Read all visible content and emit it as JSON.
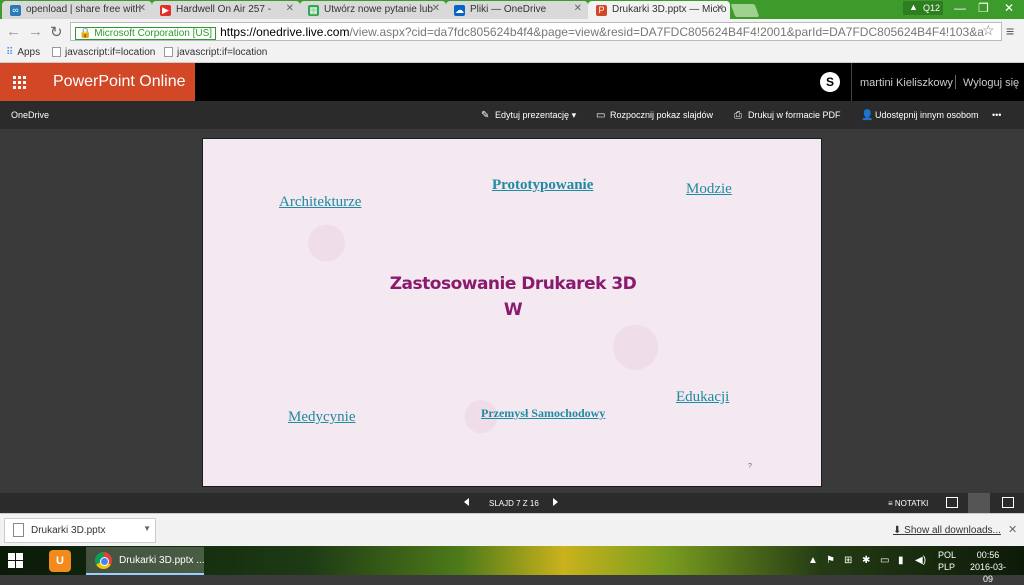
{
  "browser": {
    "tabs": [
      {
        "label": "openload | share free with",
        "icon": "openload-icon",
        "color": "#2a7ab8",
        "active": false
      },
      {
        "label": "Hardwell On Air 257 - ",
        "icon": "youtube-icon",
        "color": "#e52d27",
        "active": false
      },
      {
        "label": "Utwórz nowe pytanie lub",
        "icon": "windows-store-icon",
        "color": "#2fa84f",
        "active": false
      },
      {
        "label": "Pliki — OneDrive",
        "icon": "onedrive-icon",
        "color": "#0a64c8",
        "active": false
      },
      {
        "label": "Drukarki 3D.pptx — Micro",
        "icon": "powerpoint-icon",
        "color": "#d24726",
        "active": true
      }
    ],
    "user_badge": "Q12",
    "secure_label": "Microsoft Corporation [US]",
    "url_host": "https://onedrive.live.com",
    "url_path": "/view.aspx?cid=da7fdc805624b4f4&page=view&resid=DA7FDC805624B4F4!2001&parId=DA7FDC805624B4F4!103&a",
    "bookmarks": [
      "Apps",
      "javascript:if=location",
      "javascript:if=location"
    ]
  },
  "office": {
    "app_title": "PowerPoint Online",
    "user_name": "martini Kieliszkowy",
    "logout": "Wyloguj się",
    "breadcrumb": "OneDrive",
    "commands": {
      "edit": "Edytuj prezentację",
      "slideshow": "Rozpocznij pokaz slajdów",
      "print": "Drukuj w formacie PDF",
      "share": "Udostępnij innym osobom",
      "more": "•••"
    }
  },
  "slide": {
    "title_line1": "Zastosowanie Drukarek 3D",
    "title_line2": "W",
    "links": {
      "architecture": "Architekturze",
      "prototyping": "Prototypowanie",
      "fashion": "Modzie",
      "medicine": "Medycynie",
      "automotive": "Przemysł Samochodowy",
      "education": "Edukacji"
    },
    "small_mark": "?"
  },
  "status": {
    "slide_counter": "SLAJD 7 Z 16",
    "notes": "NOTATKI"
  },
  "downloads": {
    "file_name": "Drukarki 3D.pptx",
    "show_all": "Show all downloads..."
  },
  "taskbar": {
    "active_window": "Drukarki 3D.pptx ...",
    "lang_line1": "POL",
    "lang_line2": "PLP",
    "time": "00:56",
    "date": "2016-03-09"
  }
}
